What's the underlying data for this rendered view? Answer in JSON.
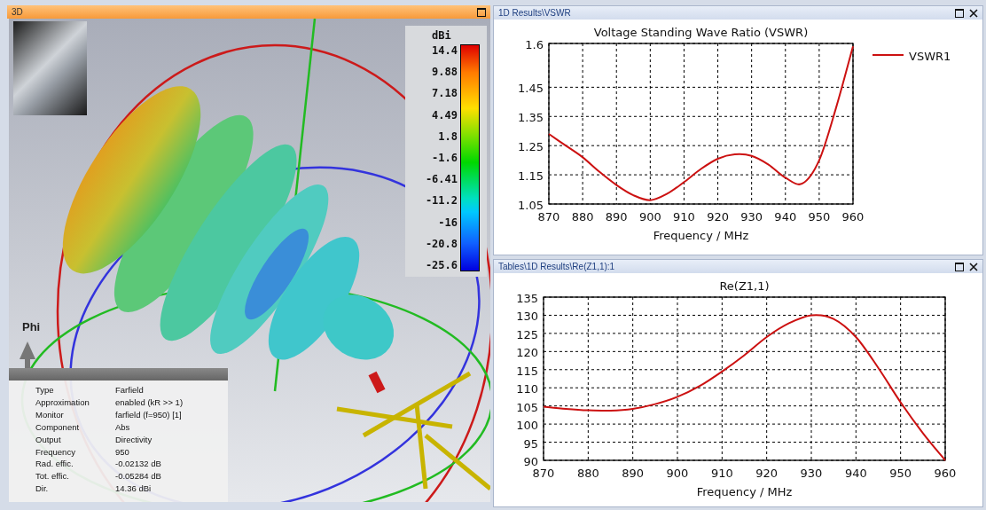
{
  "view3d": {
    "title": "3D",
    "axis_label": "Phi",
    "colorbar": {
      "unit": "dBi",
      "ticks": [
        "14.4",
        "9.88",
        "7.18",
        "4.49",
        "1.8",
        "-1.6",
        "-6.41",
        "-11.2",
        "-16",
        "-20.8",
        "-25.6"
      ]
    },
    "info": [
      {
        "label": "Type",
        "value": "Farfield"
      },
      {
        "label": "Approximation",
        "value": "enabled (kR >> 1)"
      },
      {
        "label": "Monitor",
        "value": "farfield (f=950) [1]"
      },
      {
        "label": "Component",
        "value": "Abs"
      },
      {
        "label": "Output",
        "value": "Directivity"
      },
      {
        "label": "Frequency",
        "value": "950"
      },
      {
        "label": "Rad. effic.",
        "value": "-0.02132 dB"
      },
      {
        "label": "Tot. effic.",
        "value": "-0.05284 dB"
      },
      {
        "label": "Dir.",
        "value": "14.36 dBi"
      }
    ]
  },
  "panels": [
    {
      "title": "1D Results\\VSWR",
      "chart_data": {
        "type": "line",
        "title": "Voltage Standing Wave Ratio (VSWR)",
        "xlabel": "Frequency / MHz",
        "x": [
          870,
          875,
          880,
          885,
          890,
          895,
          900,
          905,
          910,
          915,
          920,
          925,
          930,
          935,
          940,
          945,
          950,
          955,
          960
        ],
        "series": [
          {
            "name": "VSWR1",
            "color": "#cc1111",
            "values": [
              1.29,
              1.25,
              1.21,
              1.16,
              1.115,
              1.08,
              1.063,
              1.085,
              1.125,
              1.17,
              1.205,
              1.22,
              1.215,
              1.185,
              1.14,
              1.12,
              1.2,
              1.38,
              1.59
            ]
          }
        ],
        "xlim": [
          870,
          960
        ],
        "ylim": [
          1.05,
          1.6
        ],
        "xticks": [
          870,
          880,
          890,
          900,
          910,
          920,
          930,
          940,
          950,
          960
        ],
        "yticks": [
          1.05,
          1.15,
          1.25,
          1.35,
          1.45,
          1.6
        ],
        "grid": true
      }
    },
    {
      "title": "Tables\\1D Results\\Re(Z1,1):1",
      "chart_data": {
        "type": "line",
        "title": "Re(Z1,1)",
        "xlabel": "Frequency / MHz",
        "x": [
          870,
          875,
          880,
          885,
          890,
          895,
          900,
          905,
          910,
          915,
          920,
          925,
          930,
          935,
          940,
          945,
          950,
          955,
          960
        ],
        "series": [
          {
            "color": "#cc1111",
            "values": [
              104.8,
              104.2,
              103.8,
              103.7,
              104.2,
              105.5,
              107.5,
              110.5,
              114.5,
              119,
              124,
              127.8,
              130,
              129,
              124,
              115.5,
              106,
              97.5,
              90
            ]
          }
        ],
        "xlim": [
          870,
          960
        ],
        "ylim": [
          90,
          135
        ],
        "xticks": [
          870,
          880,
          890,
          900,
          910,
          920,
          930,
          940,
          950,
          960
        ],
        "yticks": [
          90,
          95,
          100,
          105,
          110,
          115,
          120,
          125,
          130,
          135
        ],
        "grid": true
      }
    }
  ]
}
